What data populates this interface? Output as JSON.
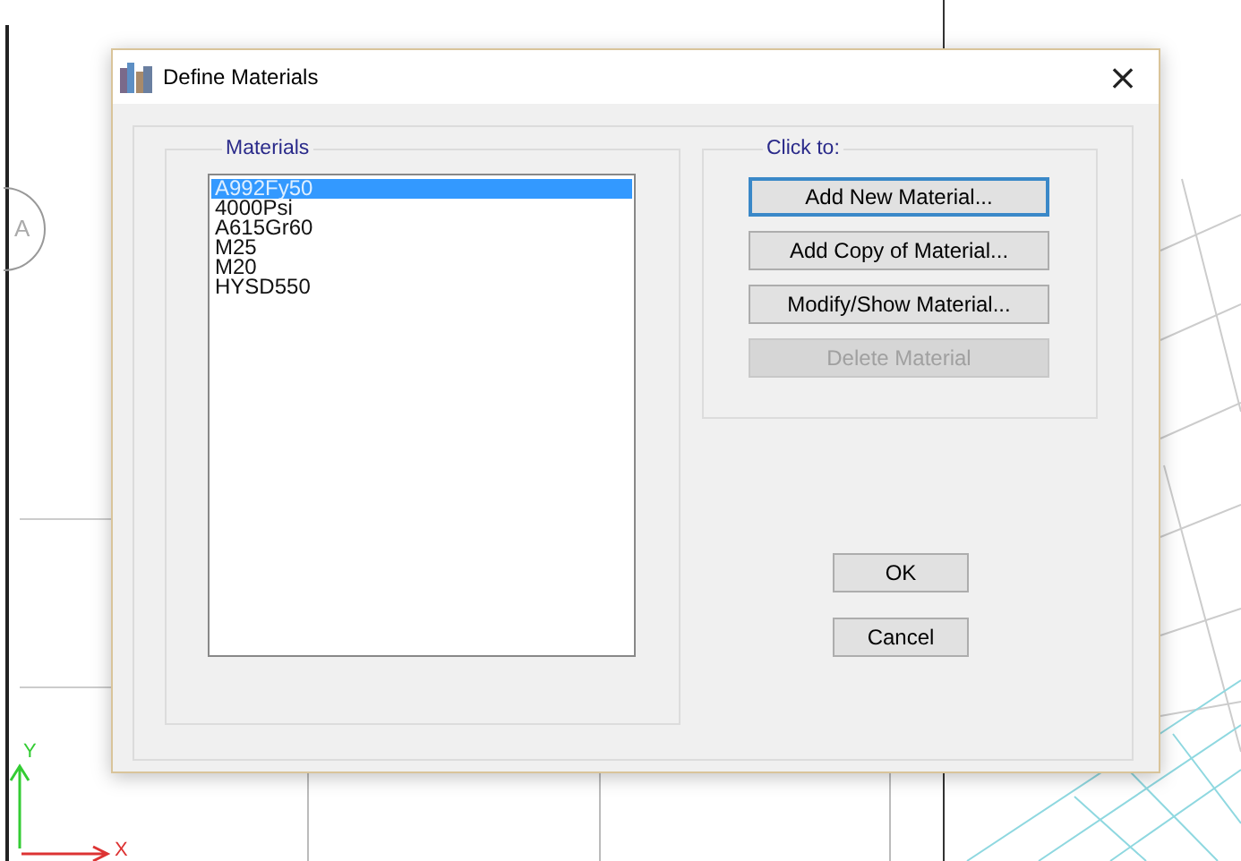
{
  "viewport": {
    "grid_bubble": "A",
    "axis_y": "Y",
    "axis_x": "X"
  },
  "window": {
    "title": "Define Materials",
    "close": "×"
  },
  "materials": {
    "label": "Materials",
    "items": [
      {
        "name": "A992Fy50",
        "selected": true
      },
      {
        "name": "4000Psi",
        "selected": false
      },
      {
        "name": "A615Gr60",
        "selected": false
      },
      {
        "name": "M25",
        "selected": false
      },
      {
        "name": "M20",
        "selected": false
      },
      {
        "name": "HYSD550",
        "selected": false
      }
    ]
  },
  "actions": {
    "label": "Click to:",
    "buttons": [
      {
        "label": "Add New Material...",
        "disabled": false,
        "focused": true
      },
      {
        "label": "Add Copy of Material...",
        "disabled": false,
        "focused": false
      },
      {
        "label": "Modify/Show Material...",
        "disabled": false,
        "focused": false
      },
      {
        "label": "Delete Material",
        "disabled": true,
        "focused": false
      }
    ]
  },
  "buttons": [
    "OK",
    "Cancel"
  ]
}
